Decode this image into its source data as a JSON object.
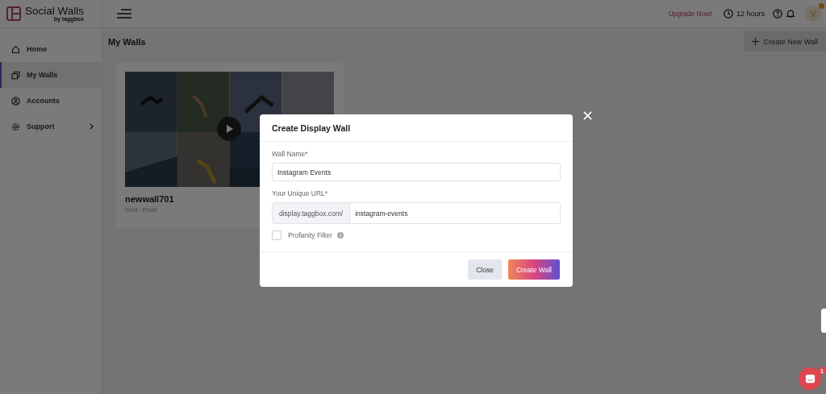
{
  "brand": {
    "name": "Social Walls",
    "by": "by",
    "partner": "taggbox"
  },
  "topbar": {
    "upgrade": "Upgrade Now!",
    "timer": "12 hours",
    "avatar": "V"
  },
  "sidebar": {
    "items": [
      {
        "label": "Home",
        "kind": "home",
        "selected": false
      },
      {
        "label": "My Walls",
        "kind": "walls",
        "selected": true
      },
      {
        "label": "Accounts",
        "kind": "account",
        "selected": false
      },
      {
        "label": "Support",
        "kind": "support",
        "selected": false,
        "expandable": true
      }
    ]
  },
  "page": {
    "title": "My Walls",
    "create_button": "Create New Wall"
  },
  "walls": [
    {
      "name": "newwall701",
      "layout": "Grid : Pixel",
      "kind": "picture"
    }
  ],
  "modal": {
    "title": "Create Display Wall",
    "wall_name": {
      "label": "Wall Name*",
      "value": "Instagram Events"
    },
    "url": {
      "label": "Your Unique URL*",
      "prefix": "display.taggbox.com/",
      "value": "instagram-events"
    },
    "profanity": {
      "label": "Profanity Filter",
      "checked": false
    },
    "buttons": [
      {
        "label": "Close",
        "kind": "secondary"
      },
      {
        "label": "Create Wall",
        "kind": "primary"
      }
    ]
  },
  "chat": {
    "badge": "1"
  }
}
